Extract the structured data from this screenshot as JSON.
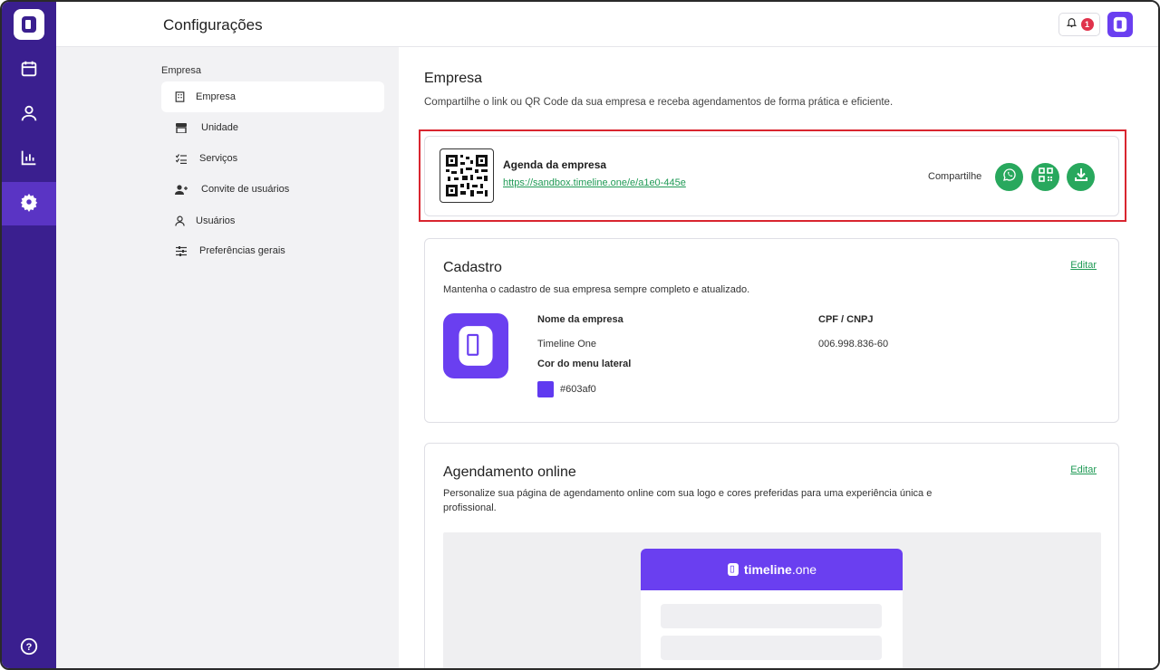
{
  "header": {
    "title": "Configurações",
    "notification_count": "1"
  },
  "rail": {
    "items": [
      "calendar-icon",
      "user-icon",
      "chart-icon",
      "gear-icon",
      "help-icon"
    ],
    "active": "gear-icon"
  },
  "subnav": {
    "heading": "Empresa",
    "items": [
      {
        "label": "Empresa",
        "icon": "building-icon",
        "active": true
      },
      {
        "label": "Unidade",
        "icon": "store-icon"
      },
      {
        "label": "Serviços",
        "icon": "list-check-icon"
      },
      {
        "label": "Convite de usuários",
        "icon": "user-plus-icon"
      },
      {
        "label": "Usuários",
        "icon": "user-icon"
      },
      {
        "label": "Preferências gerais",
        "icon": "sliders-icon"
      }
    ]
  },
  "main": {
    "title": "Empresa",
    "description": "Compartilhe o link ou QR Code da sua empresa e receba agendamentos de forma prática e eficiente.",
    "agenda": {
      "title": "Agenda da empresa",
      "link": "https://sandbox.timeline.one/e/a1e0-445e",
      "share_label": "Compartilhe"
    },
    "cadastro": {
      "title": "Cadastro",
      "edit": "Editar",
      "description": "Mantenha o cadastro de sua empresa sempre completo e atualizado.",
      "name_label": "Nome da empresa",
      "name_value": "Timeline One",
      "doc_label": "CPF / CNPJ",
      "doc_value": "006.998.836-60",
      "color_label": "Cor do menu lateral",
      "color_value": "#603af0"
    },
    "online": {
      "title": "Agendamento online",
      "edit": "Editar",
      "description": "Personalize sua página de agendamento online com sua logo e cores preferidas para uma experiência única e profissional.",
      "preview_brand_a": "timeline",
      "preview_brand_b": ".one"
    }
  },
  "colors": {
    "rail": "#3a1f8f",
    "accent": "#6a3ff0",
    "green": "#28a85d",
    "highlight": "#d9252f"
  }
}
